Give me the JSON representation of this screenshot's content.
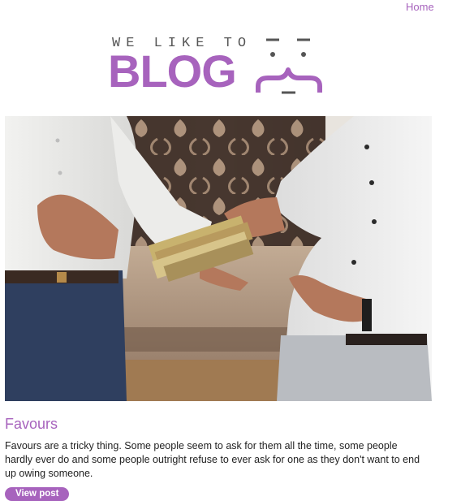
{
  "nav": {
    "home_label": "Home"
  },
  "logo": {
    "tagline": "WE LIKE TO",
    "word": "BLOG",
    "icon": "smiley-brace-icon"
  },
  "post": {
    "title": "Favours",
    "excerpt": "Favours are a tricky thing. Some people seem to ask for them all the time, some people hardly ever do and some people outright refuse to ever ask for one as they don't want to end up owing someone.",
    "button_label": "View post",
    "image": "photo of two men in white shirts exchanging a bundle of banknotes"
  },
  "colors": {
    "accent": "#a763bd",
    "text": "#222222",
    "tagline": "#555555"
  }
}
